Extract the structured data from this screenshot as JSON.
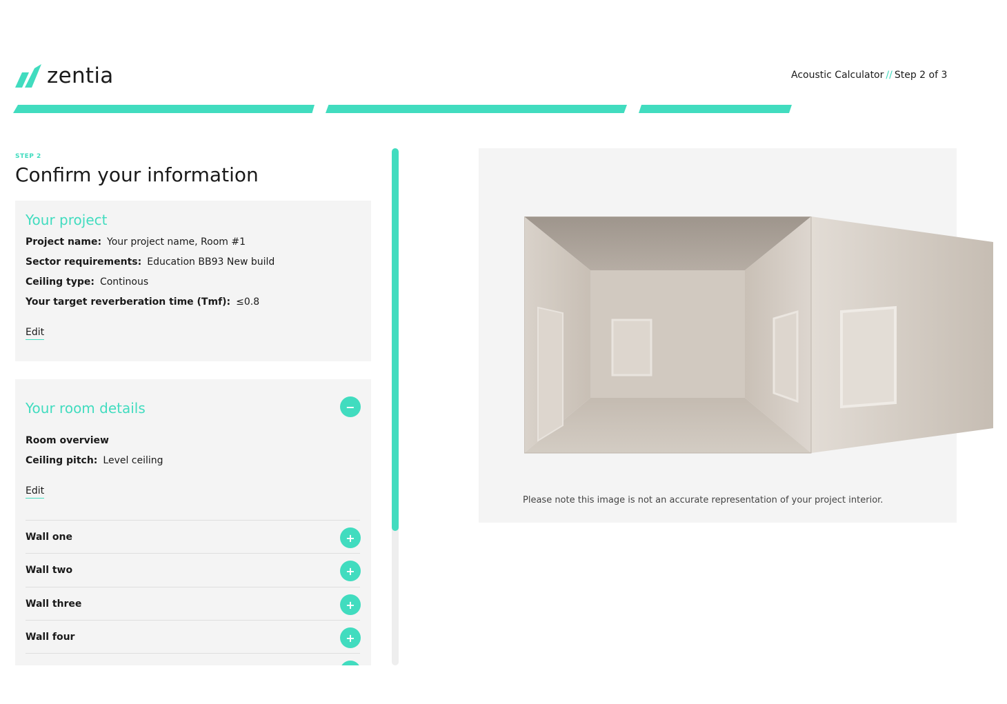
{
  "brand": {
    "name": "zentia",
    "accent": "#41dcbf"
  },
  "header": {
    "app_name": "Acoustic Calculator",
    "separator": "//",
    "step_text": "Step 2 of 3"
  },
  "progress": {
    "segments": 3,
    "current": 2
  },
  "step": {
    "label": "STEP 2",
    "title": "Confirm your information"
  },
  "project": {
    "title": "Your project",
    "fields": [
      {
        "label": "Project name:",
        "value": "Your project name, Room #1"
      },
      {
        "label": "Sector requirements:",
        "value": "Education BB93 New build"
      },
      {
        "label": "Ceiling type:",
        "value": "Continous"
      },
      {
        "label": "Your target reverberation time (Tmf):",
        "value": "≤0.8"
      }
    ],
    "edit_label": "Edit"
  },
  "room": {
    "title": "Your room details",
    "collapse_icon": "−",
    "overview_label": "Room overview",
    "ceiling_label": "Ceiling pitch:",
    "ceiling_value": "Level ceiling",
    "edit_label": "Edit",
    "expand_icon": "+",
    "walls": [
      "Wall one",
      "Wall two",
      "Wall three",
      "Wall four"
    ]
  },
  "preview": {
    "note": "Please note this image is not an accurate representation of your project interior."
  }
}
